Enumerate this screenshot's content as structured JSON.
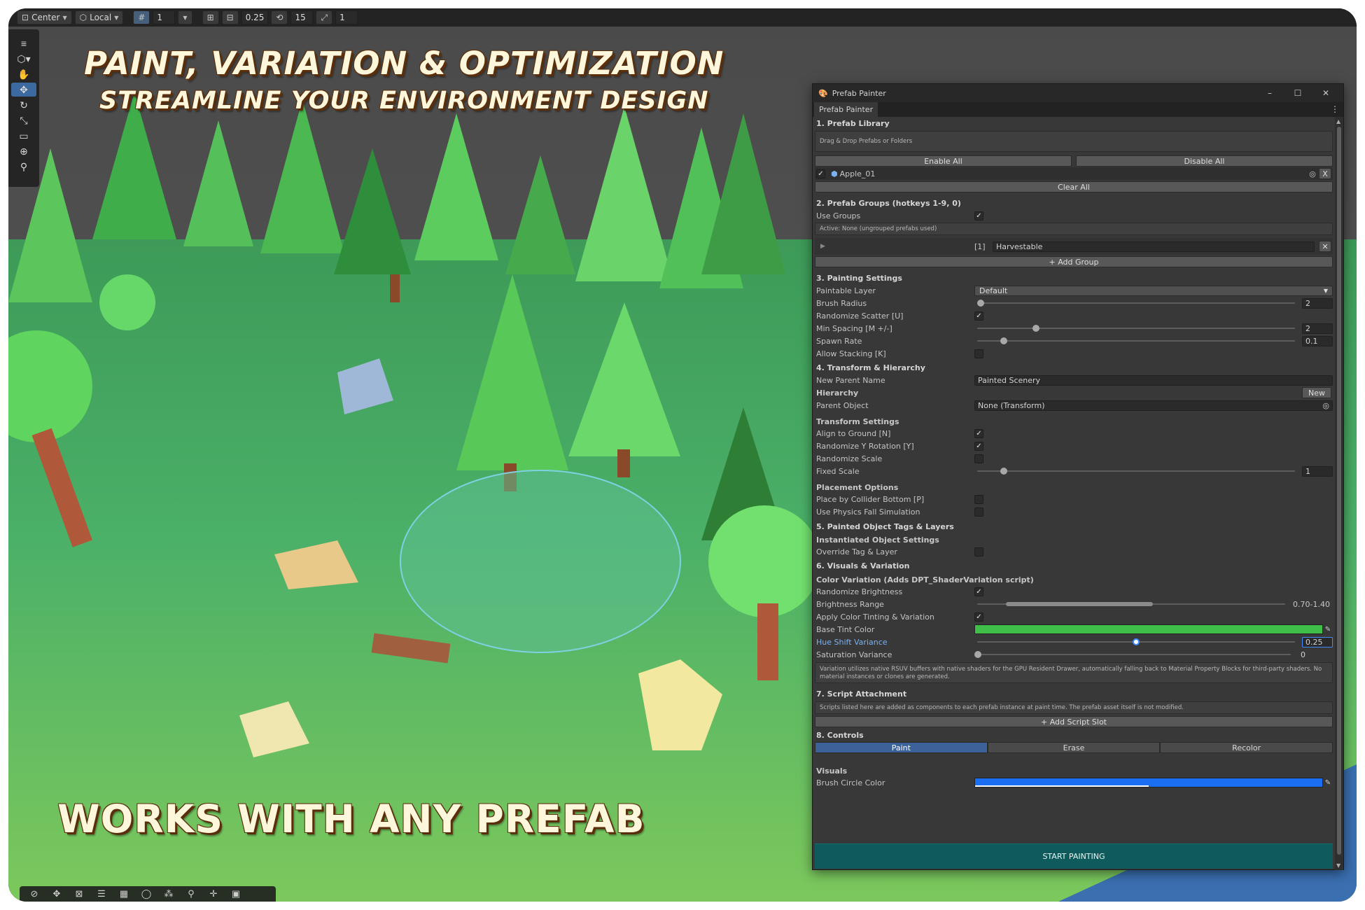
{
  "headlines": {
    "line1": "PAINT, VARIATION & OPTIMIZATION",
    "line2": "STREAMLINE YOUR ENVIRONMENT DESIGN",
    "line3": "WORKS WITH ANY PREFAB"
  },
  "toolbar": {
    "pivot": "Center",
    "space": "Local",
    "grid_value": "1",
    "snap_increment": "0.25",
    "rotation_snap": "15",
    "scale_snap": "1"
  },
  "window": {
    "title": "Prefab Painter",
    "tab": "Prefab Painter",
    "kebab": "⋮",
    "minimize": "–",
    "maximize": "☐",
    "close": "✕"
  },
  "library": {
    "heading": "1. Prefab Library",
    "drop_hint": "Drag & Drop Prefabs or Folders",
    "enable_all": "Enable All",
    "disable_all": "Disable All",
    "item_name": "Apple_01",
    "item_remove": "X",
    "clear_all": "Clear All"
  },
  "groups": {
    "heading": "2. Prefab Groups  (hotkeys 1-9, 0)",
    "use_groups_label": "Use Groups",
    "active_hint": "Active: None  (ungrouped prefabs used)",
    "group_index": "[1]",
    "group_name": "Harvestable",
    "add_group": "+ Add Group"
  },
  "painting": {
    "heading": "3. Painting Settings",
    "paintable_layer_label": "Paintable Layer",
    "paintable_layer_value": "Default",
    "brush_radius_label": "Brush Radius",
    "brush_radius_value": "2",
    "randomize_scatter_label": "Randomize Scatter  [U]",
    "min_spacing_label": "Min Spacing  [M +/-]",
    "min_spacing_value": "2",
    "spawn_rate_label": "Spawn Rate",
    "spawn_rate_value": "0.1",
    "allow_stacking_label": "Allow Stacking  [K]"
  },
  "transform": {
    "heading": "4. Transform & Hierarchy",
    "new_parent_label": "New Parent Name",
    "new_parent_value": "Painted Scenery",
    "hierarchy_sub": "Hierarchy",
    "new_button": "New",
    "parent_object_label": "Parent Object",
    "parent_object_value": "None (Transform)",
    "transform_sub": "Transform Settings",
    "align_ground_label": "Align to Ground  [N]",
    "random_y_label": "Randomize Y Rotation  [Y]",
    "random_scale_label": "Randomize Scale",
    "fixed_scale_label": "Fixed Scale",
    "fixed_scale_value": "1",
    "placement_sub": "Placement Options",
    "collider_bottom_label": "Place by Collider Bottom  [P]",
    "physics_fall_label": "Use Physics Fall Simulation"
  },
  "tags": {
    "heading": "5. Painted Object Tags & Layers",
    "inst_sub": "Instantiated Object Settings",
    "override_label": "Override Tag & Layer"
  },
  "visuals": {
    "heading": "6. Visuals & Variation",
    "color_sub": "Color Variation (Adds DPT_ShaderVariation script)",
    "rand_brightness_label": "Randomize Brightness",
    "brightness_range_label": "Brightness Range",
    "brightness_range_value": "0.70-1.40",
    "apply_tint_label": "Apply Color Tinting & Variation",
    "base_tint_label": "Base Tint Color",
    "base_tint_color": "#3fbf4a",
    "hue_shift_label": "Hue Shift Variance",
    "hue_shift_value": "0.25",
    "saturation_label": "Saturation Variance",
    "saturation_value": "0",
    "help": "Variation utilizes native RSUV buffers with native shaders for the GPU Resident Drawer, automatically falling back to Material Property Blocks for third-party shaders. No material instances or clones are generated."
  },
  "script": {
    "heading": "7. Script Attachment",
    "help": "Scripts listed here are added as components to each prefab instance at paint time. The prefab asset itself is not modified.",
    "add_slot": "+ Add Script Slot"
  },
  "controls": {
    "heading": "8. Controls",
    "paint": "Paint",
    "erase": "Erase",
    "recolor": "Recolor",
    "visuals_sub": "Visuals",
    "brush_circle_label": "Brush Circle Color",
    "brush_circle_color": "#1a6ef2",
    "start": "START PAINTING"
  },
  "colors": {
    "accent": "#3f8dff",
    "start_button": "#0f5b5b",
    "headline_fill": "#fff7dc",
    "headline_outline": "#5a2e0a"
  }
}
